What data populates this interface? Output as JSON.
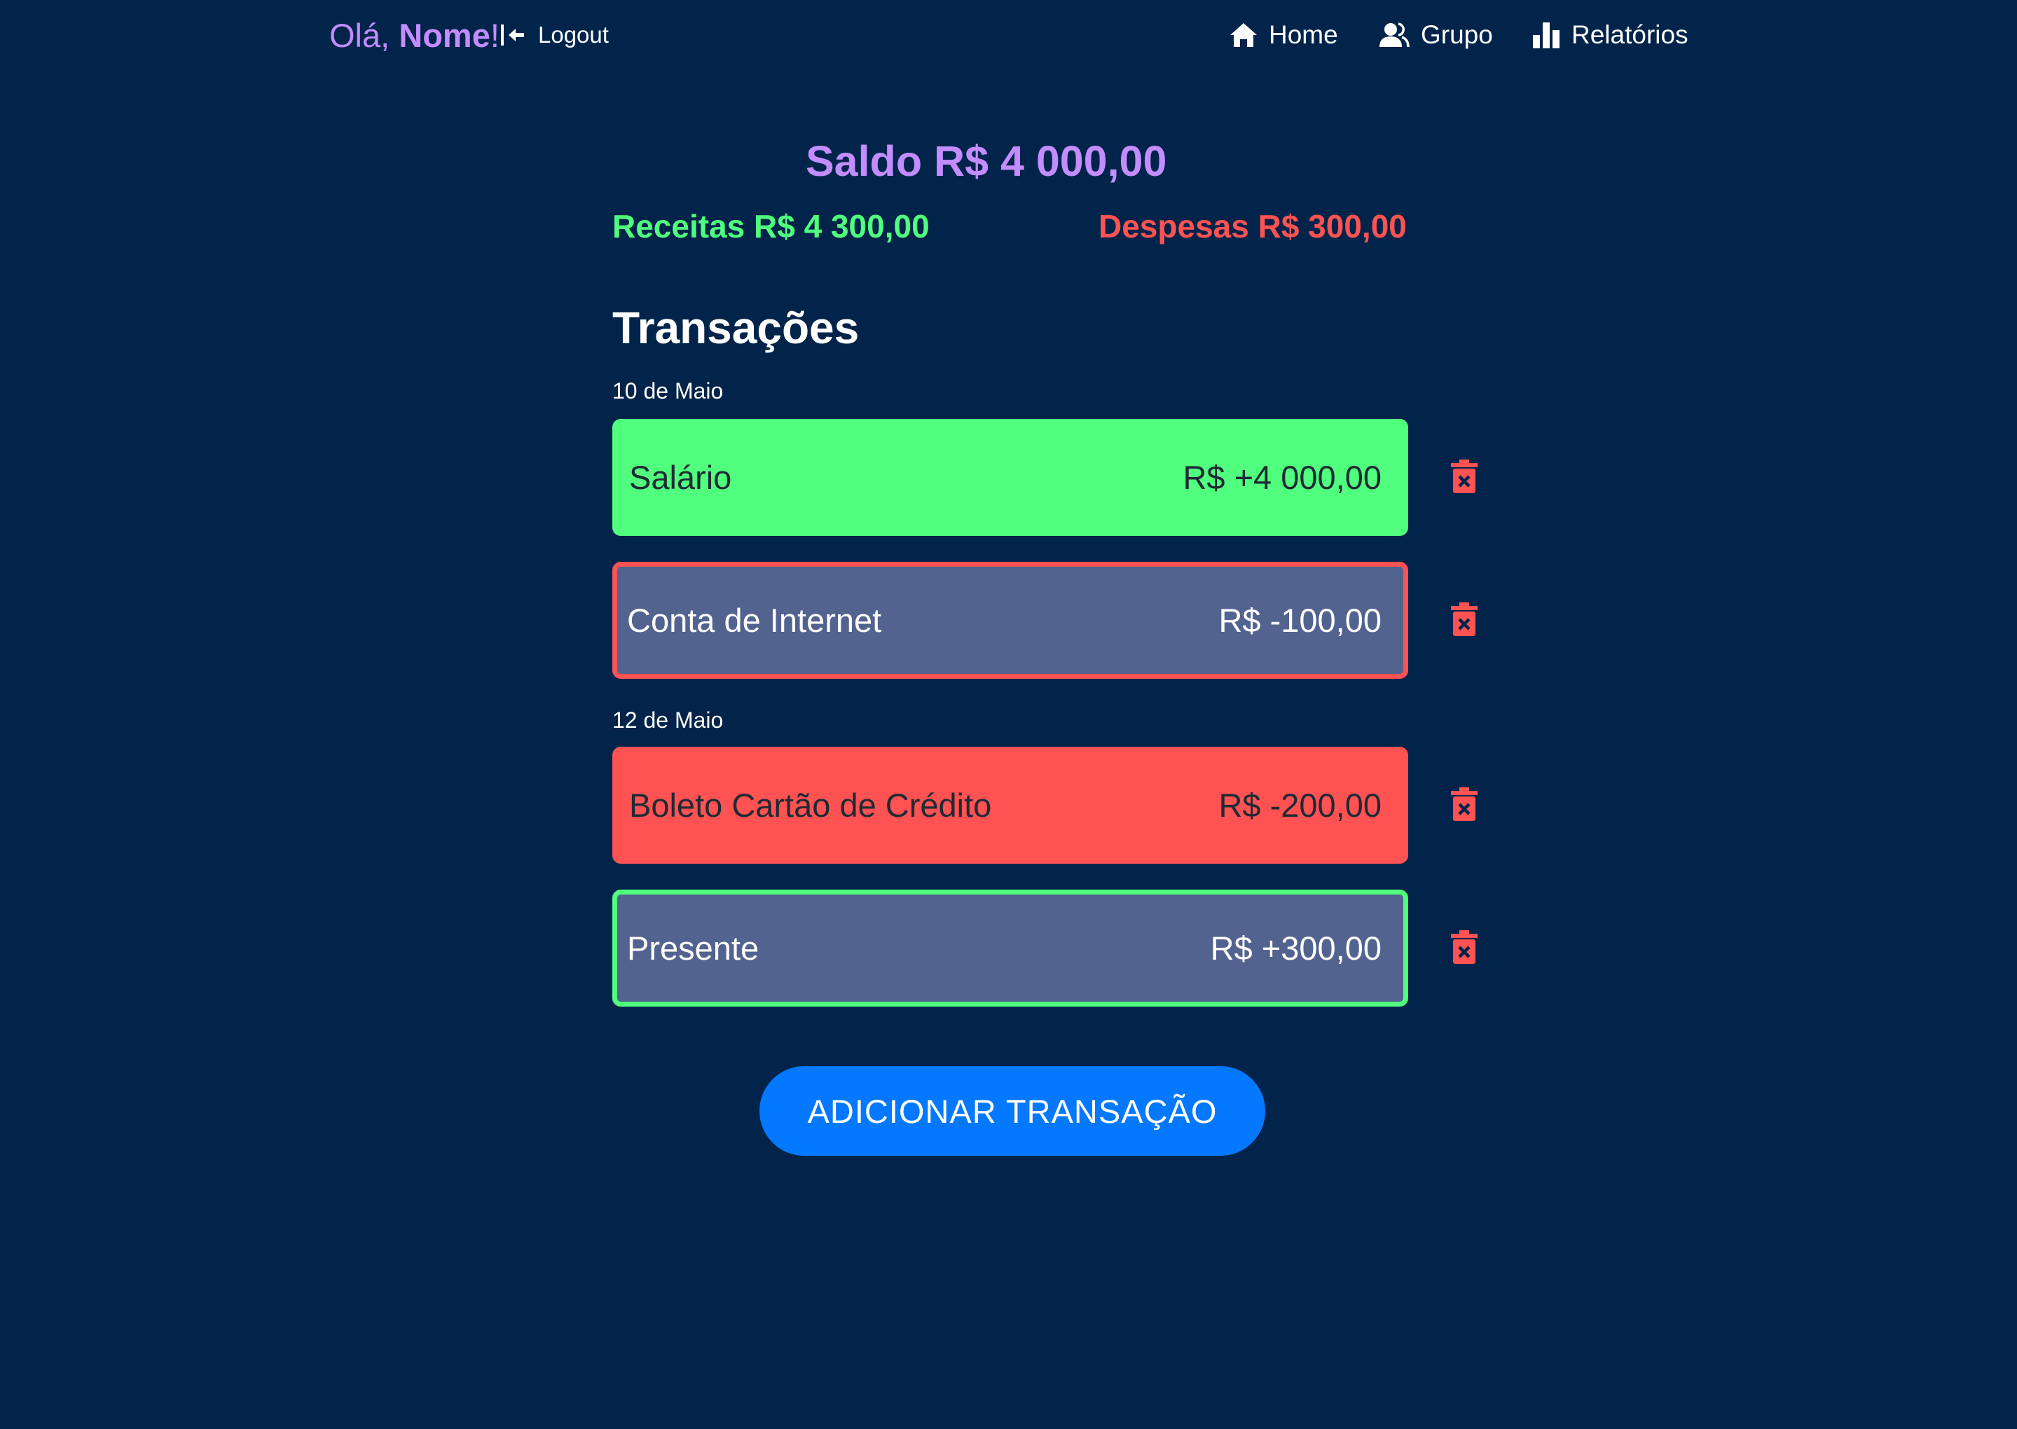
{
  "header": {
    "greeting_prefix": "Olá, ",
    "greeting_name": "Nome",
    "greeting_suffix": "!",
    "logout_label": "Logout",
    "logout_icon": "logout-arrow-icon",
    "nav": [
      {
        "label": "Home",
        "icon": "home-icon"
      },
      {
        "label": "Grupo",
        "icon": "users-icon"
      },
      {
        "label": "Relatórios",
        "icon": "bar-chart-icon"
      }
    ]
  },
  "summary": {
    "saldo": "Saldo R$ 4 000,00",
    "receitas": "Receitas R$ 4 300,00",
    "despesas": "Despesas R$ 300,00"
  },
  "transactions": {
    "title": "Transações",
    "groups": [
      {
        "date": "10 de Maio",
        "items": [
          {
            "name": "Salário",
            "amount": "R$ +4 000,00"
          },
          {
            "name": "Conta de Internet",
            "amount": "R$ -100,00"
          }
        ]
      },
      {
        "date": "12 de Maio",
        "items": [
          {
            "name": "Boleto Cartão de Crédito",
            "amount": "R$ -200,00"
          },
          {
            "name": "Presente",
            "amount": "R$ +300,00"
          }
        ]
      }
    ],
    "delete_icon": "trash-delete-icon"
  },
  "actions": {
    "add_label": "ADICIONAR TRANSAÇÃO"
  },
  "colors": {
    "background": "#03244a",
    "accent_purple": "#c38cff",
    "income_green": "#4fff7d",
    "expense_red": "#ff5252",
    "card_neutral": "#52638f",
    "button_blue": "#0478ff"
  }
}
